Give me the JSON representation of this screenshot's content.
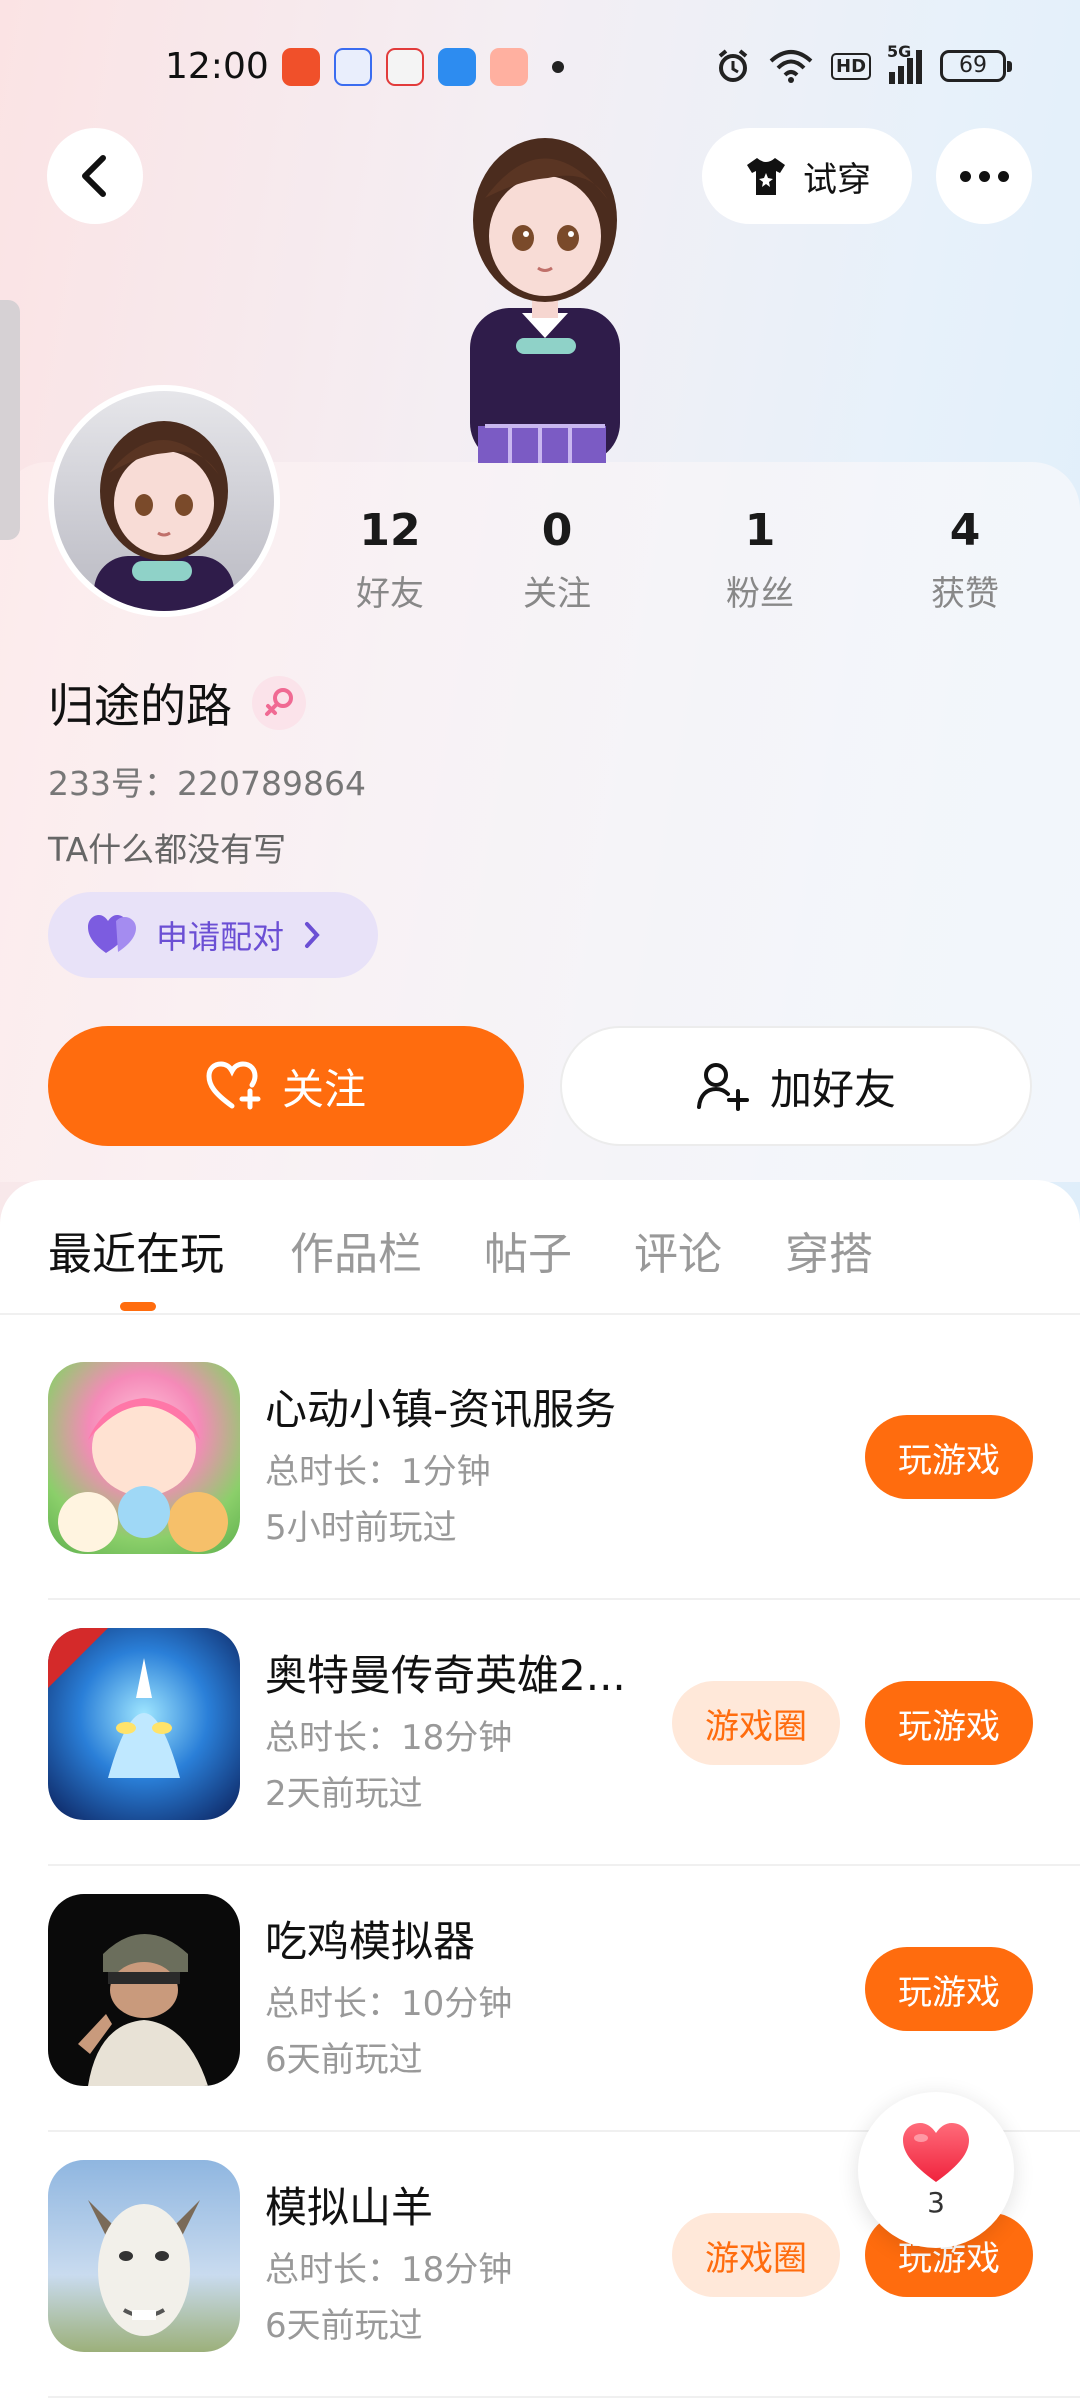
{
  "status_bar": {
    "time": "12:00",
    "battery": "69",
    "network": "5G",
    "hd": "HD"
  },
  "nav": {
    "try_on_label": "试穿"
  },
  "profile": {
    "nickname": "归途的路",
    "uid": "233号：220789864",
    "bio": "TA什么都没有写",
    "pair_label": "申请配对"
  },
  "stats": [
    {
      "value": "12",
      "label": "好友"
    },
    {
      "value": "0",
      "label": "关注"
    },
    {
      "value": "1",
      "label": "粉丝"
    },
    {
      "value": "4",
      "label": "获赞"
    }
  ],
  "actions": {
    "follow_label": "关注",
    "add_friend_label": "加好友"
  },
  "tabs": [
    {
      "label": "最近在玩",
      "active": true
    },
    {
      "label": "作品栏",
      "active": false
    },
    {
      "label": "帖子",
      "active": false
    },
    {
      "label": "评论",
      "active": false
    },
    {
      "label": "穿搭",
      "active": false
    }
  ],
  "games": [
    {
      "name": "心动小镇-资讯服务",
      "duration": "总时长：1分钟",
      "last_played": "5小时前玩过",
      "has_circle": false,
      "play_label": "玩游戏",
      "circle_label": ""
    },
    {
      "name": "奥特曼传奇英雄2...",
      "duration": "总时长：18分钟",
      "last_played": "2天前玩过",
      "has_circle": true,
      "play_label": "玩游戏",
      "circle_label": "游戏圈"
    },
    {
      "name": "吃鸡模拟器",
      "duration": "总时长：10分钟",
      "last_played": "6天前玩过",
      "has_circle": false,
      "play_label": "玩游戏",
      "circle_label": ""
    },
    {
      "name": "模拟山羊",
      "duration": "总时长：18分钟",
      "last_played": "6天前玩过",
      "has_circle": true,
      "play_label": "玩游戏",
      "circle_label": "游戏圈"
    }
  ],
  "floating_like": {
    "count": "3"
  },
  "colors": {
    "accent": "#ff6c0e",
    "accent_light": "#ffe8d9",
    "pair_bg": "#e8e2f8",
    "pair_text": "#6b4fd4"
  }
}
